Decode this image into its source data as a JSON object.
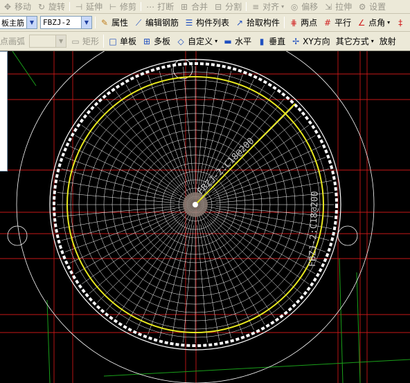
{
  "toolbar_top": {
    "move": "移动",
    "rotate": "旋转",
    "extend": "延伸",
    "trim": "修剪",
    "break": "打断",
    "merge": "合并",
    "split": "分割",
    "align": "对齐",
    "offset": "偏移",
    "stretch": "拉伸",
    "settings": "设置"
  },
  "toolbar_main": {
    "category_label": "板主筋",
    "component_value": "FBZJ-2",
    "properties": "属性",
    "edit_rebar": "编辑钢筋",
    "component_list": "构件列表",
    "pick_component": "拾取构件",
    "two_points": "两点",
    "parallel": "平行",
    "point_angle": "点角"
  },
  "toolbar_draw": {
    "point_arc": "点画弧",
    "rectangle": "矩形",
    "single_board": "单板",
    "multi_board": "多板",
    "custom": "自定义",
    "horizontal": "水平",
    "vertical": "垂直",
    "xy_direction": "XY方向",
    "other_methods": "其它方式",
    "radial": "放射"
  },
  "drawing": {
    "rebar_label_radial": "FBZJ-2:C18@200",
    "rebar_label_ring": "FBZJ-2:C18@200",
    "colors": {
      "grid_red": "#c81818",
      "grid_green": "#1aa01a",
      "circle_white": "#ffffff",
      "ring_yellow": "#e8e820",
      "label_gray": "#c8c8c8"
    }
  }
}
